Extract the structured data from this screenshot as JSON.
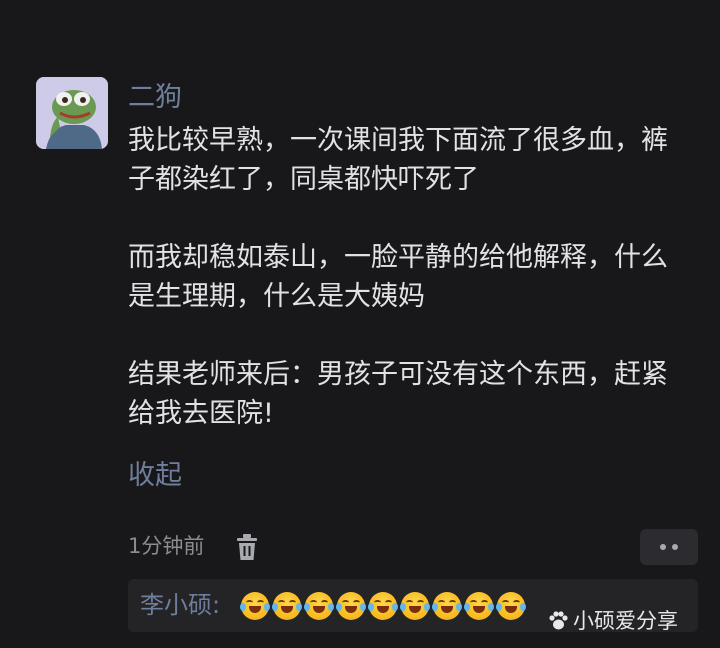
{
  "comment": {
    "username": "二狗",
    "paragraphs": [
      "我比较早熟，一次课间我下面流了很多血，裤子都染红了，同桌都快吓死了",
      "而我却稳如泰山，一脸平静的给他解释，什么是生理期，什么是大姨妈",
      "结果老师来后：男孩子可没有这个东西，赶紧给我去医院!"
    ],
    "collapse_label": "收起",
    "timestamp": "1分钟前",
    "delete_icon": "trash-icon",
    "more_icon": "more-dots-icon"
  },
  "reply": {
    "author": "李小硕:",
    "emoji": "laughing-with-tears",
    "emoji_count": 9
  },
  "watermark": {
    "text": "小硕爱分享",
    "icon": "paw-icon"
  },
  "colors": {
    "background": "#18181a",
    "username": "#6e7e9c",
    "body_text": "#e2e2e4",
    "muted_text": "#8c8c90",
    "reply_bg": "#242427"
  }
}
